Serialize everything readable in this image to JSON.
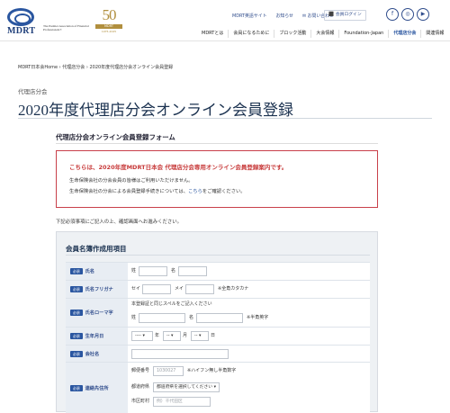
{
  "brand": {
    "logo_text": "MDRT",
    "association": "The Premier Association of Financial Professionals®",
    "anniversary_number": "50",
    "anniversary_band": "MDRT",
    "anniversary_years": "1975-2025"
  },
  "utility_nav": [
    "MDRT英語サイト",
    "お知らせ",
    "✉ お問い合わせ"
  ],
  "login_label": "⬛ 会員ログイン",
  "social": [
    "f",
    "◎",
    "▶"
  ],
  "main_nav": [
    {
      "label": "MDRTとは"
    },
    {
      "label": "会員になるために"
    },
    {
      "label": "ブロック活動"
    },
    {
      "label": "大会情報"
    },
    {
      "label": "Foundation-Japan"
    },
    {
      "label": "代理店分会",
      "active": true
    },
    {
      "label": "関連情報"
    }
  ],
  "breadcrumb": "MDRT日本会Home › 代理店分会 › 2020年度代理店分会オンライン会員登録",
  "page_subtitle": "代理店分会",
  "page_title": "2020年度代理店分会オンライン会員登録",
  "section_title": "代理店分会オンライン会員登録フォーム",
  "notice": {
    "headline": "こちらは、2020年度MDRT日本会 代理店分会専用オンライン会員登録案内です。",
    "line1": "生命保険会社の分会会員の皆様はご利用いただけません。",
    "line2_prefix": "生命保険会社の分会による会員登録手続きについては、",
    "line2_link": "こちら",
    "line2_suffix": "をご確認ください。"
  },
  "intro": "下記必須事項にご記入の上、確認画面へお進みください。",
  "form": {
    "title": "会員名簿作成用項目",
    "required_tag": "必須",
    "name": {
      "label": "氏名",
      "sei": "姓",
      "mei": "名"
    },
    "kana": {
      "label": "氏名フリガナ",
      "sei": "セイ",
      "mei": "メイ",
      "note": "※全角カタカナ"
    },
    "roman": {
      "label": "氏名ローマ字",
      "hint": "本登録証と同じスペルをご記入ください",
      "sei": "姓",
      "mei": "名",
      "note": "※半角英字"
    },
    "birth": {
      "label": "生年月日",
      "year_value": "----",
      "year_unit": "年",
      "month_value": "--",
      "month_unit": "月",
      "day_value": "--",
      "day_unit": "日"
    },
    "company": {
      "label": "会社名"
    },
    "contact": {
      "label": "連絡先住所",
      "zip_label": "郵便番号",
      "zip_placeholder": "1030027",
      "zip_note": "※ハイフン無し半角数字",
      "pref_label": "都道府県",
      "pref_value": "都道府県を選択してください",
      "city_label": "市区町村",
      "city_placeholder": "例）千代田区"
    }
  }
}
